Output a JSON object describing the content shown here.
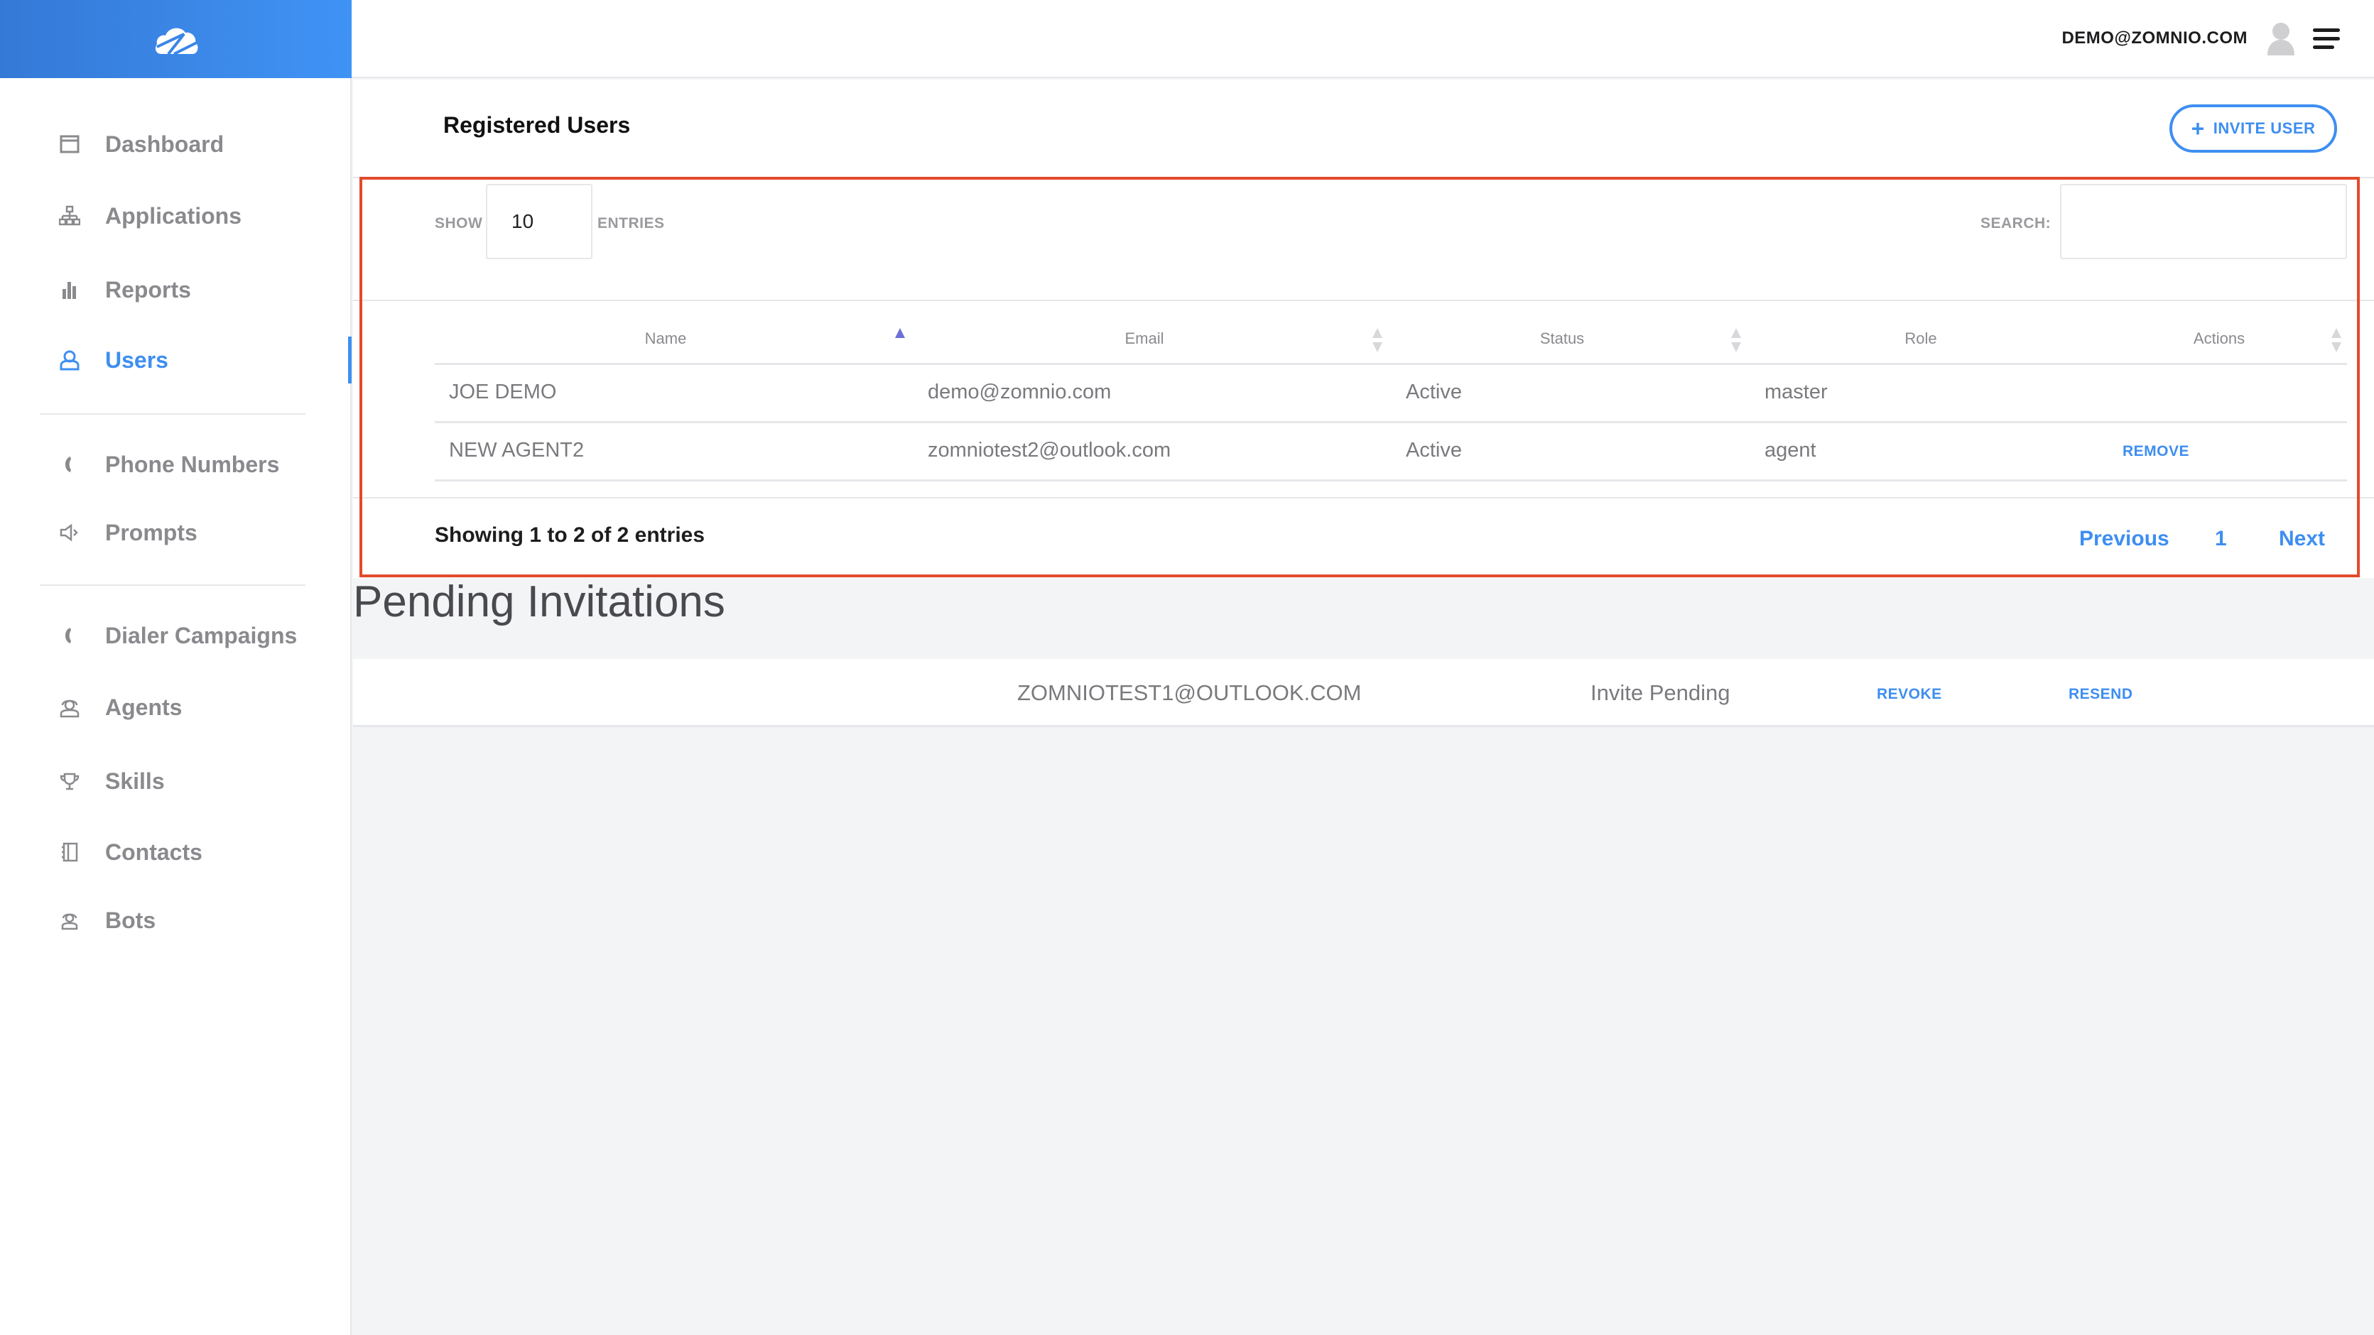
{
  "brand": {
    "logo_icon": "cloud-logo-icon",
    "accent": "#3e8ef1",
    "gradient": [
      "#3579d6",
      "#3f93f5"
    ]
  },
  "header": {
    "user_email": "DEMO@ZOMNIO.COM",
    "avatar_icon": "user-avatar-icon",
    "menu_icon": "hamburger-menu-icon"
  },
  "sidebar": {
    "items": [
      {
        "label": "Dashboard",
        "icon": "dashboard-icon"
      },
      {
        "label": "Applications",
        "icon": "sitemap-icon"
      },
      {
        "label": "Reports",
        "icon": "bar-chart-icon"
      },
      {
        "label": "Users",
        "icon": "user-icon",
        "active": true
      },
      {
        "label": "Phone Numbers",
        "icon": "phone-icon"
      },
      {
        "label": "Prompts",
        "icon": "speaker-icon"
      },
      {
        "label": "Dialer Campaigns",
        "icon": "phone-icon"
      },
      {
        "label": "Agents",
        "icon": "headset-agent-icon"
      },
      {
        "label": "Skills",
        "icon": "trophy-icon"
      },
      {
        "label": "Contacts",
        "icon": "address-book-icon"
      },
      {
        "label": "Bots",
        "icon": "bot-icon"
      }
    ]
  },
  "registered_users": {
    "title": "Registered Users",
    "invite_button": {
      "icon": "+",
      "label": "INVITE USER"
    },
    "show_label": "SHOW",
    "page_length": "10",
    "entries_label": "ENTRIES",
    "search_label": "SEARCH:",
    "search_value": "",
    "columns": [
      "Name",
      "Email",
      "Status",
      "Role",
      "Actions"
    ],
    "sorted_column": "Name",
    "sort_direction": "ascending",
    "rows": [
      {
        "name": "JOE DEMO",
        "email": "demo@zomnio.com",
        "status": "Active",
        "role": "master",
        "action": ""
      },
      {
        "name": "NEW AGENT2",
        "email": "zomniotest2@outlook.com",
        "status": "Active",
        "role": "agent",
        "action": "REMOVE"
      }
    ],
    "info": "Showing 1 to 2 of 2 entries",
    "pagination": {
      "previous": "Previous",
      "current": "1",
      "next": "Next"
    }
  },
  "pending_invitations": {
    "title": "Pending Invitations",
    "rows": [
      {
        "email": "ZOMNIOTEST1@OUTLOOK.COM",
        "status": "Invite Pending",
        "revoke": "REVOKE",
        "resend": "RESEND"
      }
    ]
  },
  "highlight_color": "#e34a2c"
}
